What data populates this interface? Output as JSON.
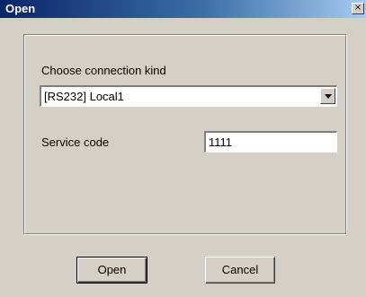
{
  "window": {
    "title": "Open",
    "close_glyph": "×"
  },
  "form": {
    "connection_label": "Choose connection kind",
    "connection_value": "[RS232] Local1",
    "service_code_label": "Service code",
    "service_code_value": "1111"
  },
  "buttons": {
    "open_label": "Open",
    "cancel_label": "Cancel"
  },
  "colors": {
    "titlebar_start": "#0a246a",
    "titlebar_end": "#a6caf0",
    "dialog_bg": "#d4d0c8"
  },
  "icons": {
    "close": "close-icon",
    "dropdown": "chevron-down-icon"
  }
}
